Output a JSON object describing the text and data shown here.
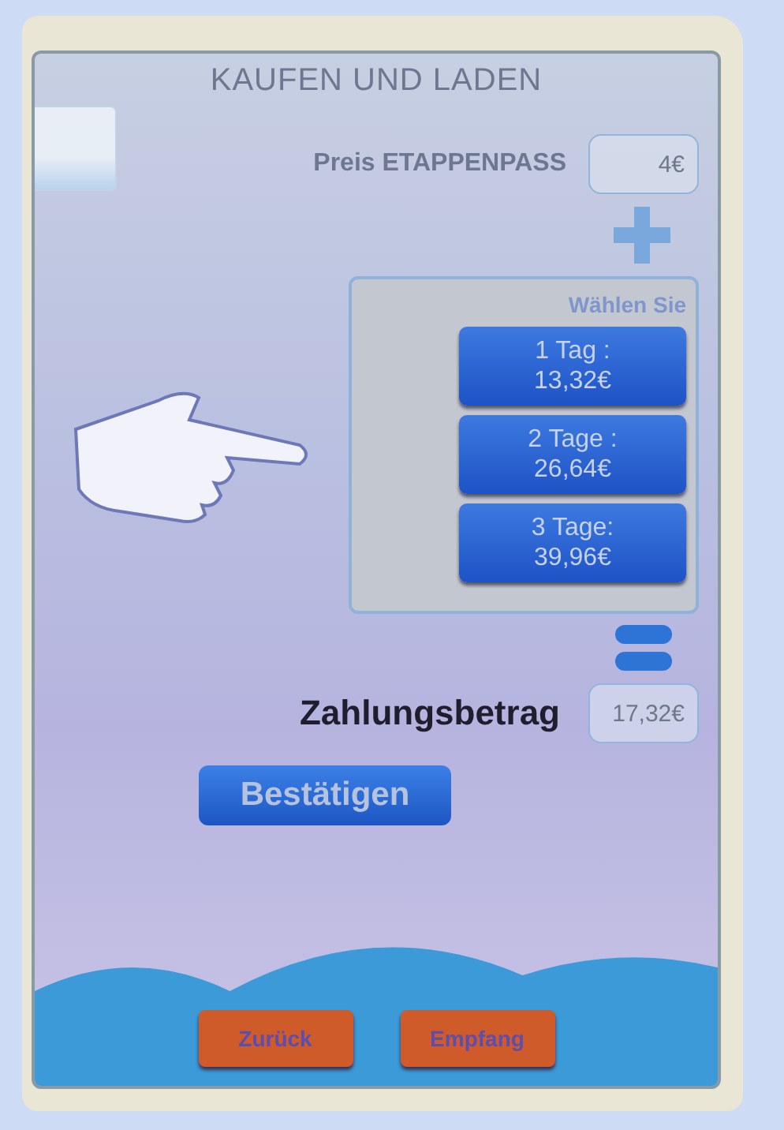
{
  "title": "KAUFEN UND LADEN",
  "price": {
    "label": "Preis ETAPPENPASS",
    "value": "4€"
  },
  "options": {
    "heading": "Wählen Sie",
    "items": [
      {
        "label": "1 Tag :",
        "price": "13,32€"
      },
      {
        "label": "2 Tage :",
        "price": "26,64€"
      },
      {
        "label": "3 Tage:",
        "price": "39,96€"
      }
    ]
  },
  "total": {
    "label": "Zahlungsbetrag",
    "value": "17,32€"
  },
  "confirm": "Bestätigen",
  "footer_buttons": [
    "Zurück",
    "Empfang"
  ]
}
